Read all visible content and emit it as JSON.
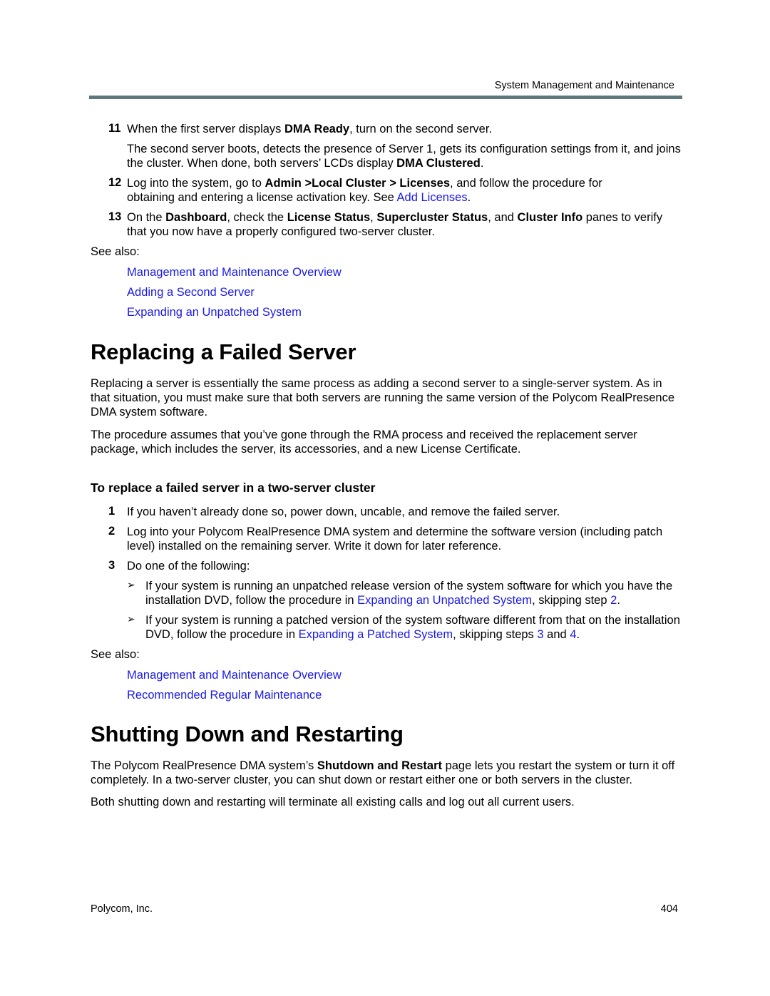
{
  "header": {
    "running_title": "System Management and Maintenance",
    "rule_color": "#5f787e"
  },
  "steps_top": [
    {
      "number": "11",
      "line": {
        "pre": "When the first server displays ",
        "bold": "DMA Ready",
        "post": ", turn on the second server."
      },
      "para": {
        "pre": "The second server boots, detects the presence of Server 1, gets its configuration settings from it, and joins the cluster. When done, both servers’ LCDs display ",
        "bold": "DMA Clustered",
        "post": "."
      }
    },
    {
      "number": "12",
      "pre": "Log into the system, go to ",
      "bold": "Admin >Local Cluster > Licenses",
      "mid": ", and follow the procedure for obtaining and entering a license activation key. See ",
      "link": "Add Licenses",
      "post": "."
    },
    {
      "number": "13",
      "pre": "On the ",
      "bold1": "Dashboard",
      "t1": ", check the ",
      "bold2": "License Status",
      "t2": ", ",
      "bold3": "Supercluster Status",
      "t3": ", and ",
      "bold4": "Cluster Info",
      "post": " panes to verify that you now have a properly configured two-server cluster."
    }
  ],
  "see_also_1": {
    "label": "See also:",
    "links": [
      "Management and Maintenance Overview",
      "Adding a Second Server",
      "Expanding an Unpatched System"
    ]
  },
  "section_replace": {
    "title": "Replacing a Failed Server",
    "para1": "Replacing a server is essentially the same process as adding a second server to a single-server system. As in that situation, you must make sure that both servers are running the same version of the Polycom RealPresence DMA system software.",
    "para2": "The procedure assumes that you’ve gone through the RMA process and received the replacement server package, which includes the server, its accessories, and a new License Certificate.",
    "procedure_title": "To replace a failed server in a two-server cluster",
    "steps": [
      {
        "number": "1",
        "text": "If you haven’t already done so, power down, uncable, and remove the failed server."
      },
      {
        "number": "2",
        "text": "Log into your Polycom RealPresence DMA system and determine the software version (including patch level) installed on the remaining server. Write it down for later reference."
      },
      {
        "number": "3",
        "text": "Do one of the following:"
      }
    ],
    "bullets": [
      {
        "icon": "➢",
        "pre": "If your system is running an unpatched release version of the system software for which you have the installation DVD, follow the procedure in ",
        "link": "Expanding an Unpatched System",
        "mid": ", skipping step ",
        "link_step": "2",
        "post": "."
      },
      {
        "icon": "➢",
        "pre": "If your system is running a patched version of the system software different from that on the installation DVD, follow the procedure in ",
        "link": "Expanding a Patched System",
        "mid": ", skipping steps ",
        "link_step1": "3",
        "and": " and ",
        "link_step2": "4",
        "post": "."
      }
    ],
    "see_also": {
      "label": "See also:",
      "links": [
        "Management and Maintenance Overview",
        "Recommended Regular Maintenance"
      ]
    }
  },
  "section_shutdown": {
    "title": "Shutting Down and Restarting",
    "para1_pre": "The Polycom RealPresence DMA system’s ",
    "para1_bold": "Shutdown and Restart",
    "para1_post": " page lets you restart the system or turn it off completely. In a two-server cluster, you can shut down or restart either one or both servers in the cluster.",
    "para2": "Both shutting down and restarting will terminate all existing calls and log out all current users."
  },
  "footer": {
    "company": "Polycom, Inc.",
    "page_number": "404"
  }
}
